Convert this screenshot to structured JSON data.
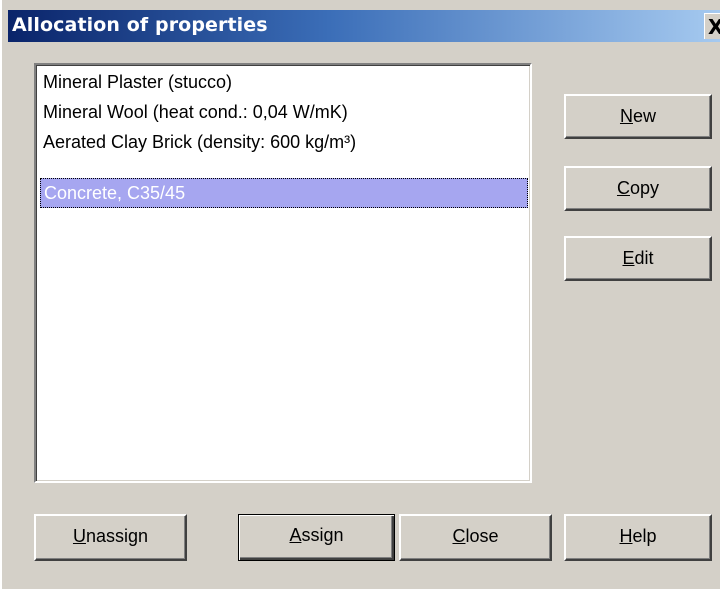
{
  "window": {
    "title": "Allocation of properties",
    "close_glyph": "X"
  },
  "materials": [
    {
      "label": "Mineral Plaster (stucco)",
      "selected": false
    },
    {
      "label": "Mineral Wool (heat cond.: 0,04 W/mK)",
      "selected": false
    },
    {
      "label": "Aerated Clay Brick (density: 600 kg/m³)",
      "selected": false
    },
    {
      "label": "Concrete, C35/45",
      "selected": true
    }
  ],
  "side_buttons": {
    "new": {
      "mnemonic": "N",
      "rest": "ew"
    },
    "copy": {
      "mnemonic": "C",
      "rest": "opy"
    },
    "edit": {
      "mnemonic": "E",
      "rest": "dit"
    }
  },
  "bottom_buttons": {
    "unassign": {
      "mnemonic": "U",
      "rest": "nassign"
    },
    "assign": {
      "mnemonic": "A",
      "rest": "ssign"
    },
    "close": {
      "mnemonic": "C",
      "rest": "lose"
    },
    "help": {
      "mnemonic": "H",
      "rest": "elp"
    }
  }
}
